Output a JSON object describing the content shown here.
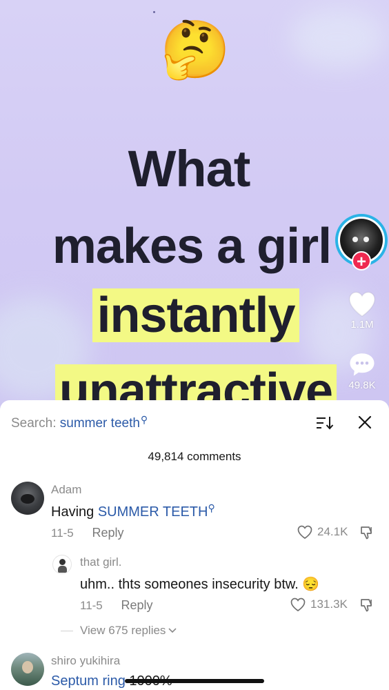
{
  "video": {
    "emoji": "🤔",
    "headline_line1": "What",
    "headline_line2": "makes a girl",
    "headline_line3": "instantly",
    "headline_line4": "unattractive",
    "likes": "1.1M",
    "comments": "49.8K",
    "follow_plus": "+"
  },
  "sheet": {
    "search_label": "Search:",
    "search_query": "summer teeth",
    "comment_count": "49,814 comments"
  },
  "comments": [
    {
      "author": "Adam",
      "text_prefix": "Having ",
      "text_link": "SUMMER TEETH",
      "date": "11-5",
      "reply_label": "Reply",
      "likes": "24.1K"
    },
    {
      "author": "that girl.",
      "text": "uhm.. thts someones insecurity btw. 😔",
      "date": "11-5",
      "reply_label": "Reply",
      "likes": "131.3K"
    }
  ],
  "view_replies": "View 675 replies",
  "next_comment": {
    "author": "shiro yukihira",
    "text_link": "Septum ring",
    "text_suffix": " 1000%"
  },
  "icons": {
    "search": "search-icon",
    "sort": "sort-icon",
    "close": "close-icon",
    "heart": "heart-icon",
    "dislike": "dislike-icon",
    "comment": "comment-bubble-icon"
  }
}
